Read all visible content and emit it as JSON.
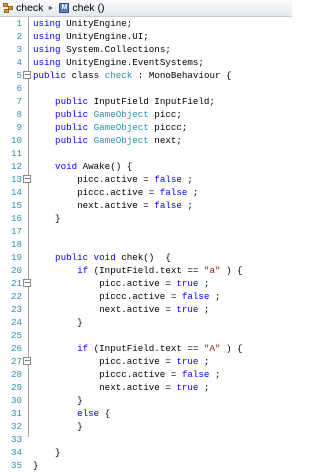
{
  "breadcrumb": {
    "class_name": "check",
    "separator": "►",
    "method_name": "chek ()",
    "method_icon_letter": "M"
  },
  "editor": {
    "theme": {
      "keyword": "#0000ff",
      "type": "#2b91af",
      "string": "#a31515",
      "line_number": "#2b91af"
    },
    "fold_markers": [
      5,
      13,
      21,
      27
    ],
    "lines": [
      {
        "n": "1",
        "code": [
          [
            "kw",
            "using"
          ],
          [
            "",
            "UnityEngine;"
          ]
        ]
      },
      {
        "n": "2",
        "code": [
          [
            "kw",
            "using"
          ],
          [
            "",
            "UnityEngine.UI;"
          ]
        ]
      },
      {
        "n": "3",
        "code": [
          [
            "kw",
            "using"
          ],
          [
            "",
            "System.Collections;"
          ]
        ]
      },
      {
        "n": "4",
        "code": [
          [
            "kw",
            "using"
          ],
          [
            "",
            "UnityEngine.EventSystems;"
          ]
        ]
      },
      {
        "n": "5",
        "code": [
          [
            "kw",
            "public"
          ],
          [
            "",
            "class"
          ],
          [
            "ty",
            "check"
          ],
          [
            "",
            ": MonoBehaviour {"
          ]
        ]
      },
      {
        "n": "6",
        "code": []
      },
      {
        "n": "7",
        "code": [
          [
            "kw",
            "    public"
          ],
          [
            "",
            "InputField InputField;"
          ]
        ]
      },
      {
        "n": "8",
        "code": [
          [
            "kw",
            "    public"
          ],
          [
            "ty",
            "GameObject"
          ],
          [
            "",
            "picc;"
          ]
        ]
      },
      {
        "n": "9",
        "code": [
          [
            "kw",
            "    public"
          ],
          [
            "ty",
            "GameObject"
          ],
          [
            "",
            "piccc;"
          ]
        ]
      },
      {
        "n": "10",
        "code": [
          [
            "kw",
            "    public"
          ],
          [
            "ty",
            "GameObject"
          ],
          [
            "",
            "next;"
          ]
        ]
      },
      {
        "n": "11",
        "code": []
      },
      {
        "n": "12",
        "code": [
          [
            "kw",
            "    void"
          ],
          [
            "",
            "Awake() {"
          ]
        ]
      },
      {
        "n": "13",
        "code": [
          [
            "",
            "        picc.active ="
          ],
          [
            "kw",
            "false"
          ],
          [
            "",
            ";"
          ]
        ]
      },
      {
        "n": "14",
        "code": [
          [
            "",
            "        piccc.active ="
          ],
          [
            "kw",
            "false"
          ],
          [
            "",
            ";"
          ]
        ]
      },
      {
        "n": "15",
        "code": [
          [
            "",
            "        next.active ="
          ],
          [
            "kw",
            "false"
          ],
          [
            "",
            ";"
          ]
        ]
      },
      {
        "n": "16",
        "code": [
          [
            "",
            "    }"
          ]
        ]
      },
      {
        "n": "17",
        "code": []
      },
      {
        "n": "18",
        "code": []
      },
      {
        "n": "19",
        "code": [
          [
            "kw",
            "    public void"
          ],
          [
            "",
            "chek()  {"
          ]
        ]
      },
      {
        "n": "20",
        "code": [
          [
            "kw",
            "        if"
          ],
          [
            "",
            "(InputField.text =="
          ],
          [
            "st",
            "\"a\""
          ],
          [
            "",
            ") {"
          ]
        ]
      },
      {
        "n": "21",
        "code": [
          [
            "",
            "            picc.active ="
          ],
          [
            "kw",
            "true"
          ],
          [
            "",
            ";"
          ]
        ]
      },
      {
        "n": "22",
        "code": [
          [
            "",
            "            piccc.active ="
          ],
          [
            "kw",
            "false"
          ],
          [
            "",
            ";"
          ]
        ]
      },
      {
        "n": "23",
        "code": [
          [
            "",
            "            next.active ="
          ],
          [
            "kw",
            "true"
          ],
          [
            "",
            ";"
          ]
        ]
      },
      {
        "n": "24",
        "code": [
          [
            "",
            "        }"
          ]
        ]
      },
      {
        "n": "25",
        "code": []
      },
      {
        "n": "26",
        "code": [
          [
            "kw",
            "        if"
          ],
          [
            "",
            "(InputField.text =="
          ],
          [
            "st",
            "\"A\""
          ],
          [
            "",
            ") {"
          ]
        ]
      },
      {
        "n": "27",
        "code": [
          [
            "",
            "            picc.active ="
          ],
          [
            "kw",
            "true"
          ],
          [
            "",
            ";"
          ]
        ]
      },
      {
        "n": "28",
        "code": [
          [
            "",
            "            piccc.active ="
          ],
          [
            "kw",
            "false"
          ],
          [
            "",
            ";"
          ]
        ]
      },
      {
        "n": "29",
        "code": [
          [
            "",
            "            next.active ="
          ],
          [
            "kw",
            "true"
          ],
          [
            "",
            ";"
          ]
        ]
      },
      {
        "n": "30",
        "code": [
          [
            "",
            "        }"
          ]
        ]
      },
      {
        "n": "31",
        "code": [
          [
            "kw",
            "        else"
          ],
          [
            "",
            "{"
          ]
        ]
      },
      {
        "n": "32",
        "code": [
          [
            "",
            "        }"
          ]
        ]
      },
      {
        "n": "33",
        "code": []
      },
      {
        "n": "34",
        "code": [
          [
            "",
            "    }"
          ]
        ]
      },
      {
        "n": "35",
        "code": [
          [
            "",
            "}"
          ]
        ]
      }
    ]
  }
}
